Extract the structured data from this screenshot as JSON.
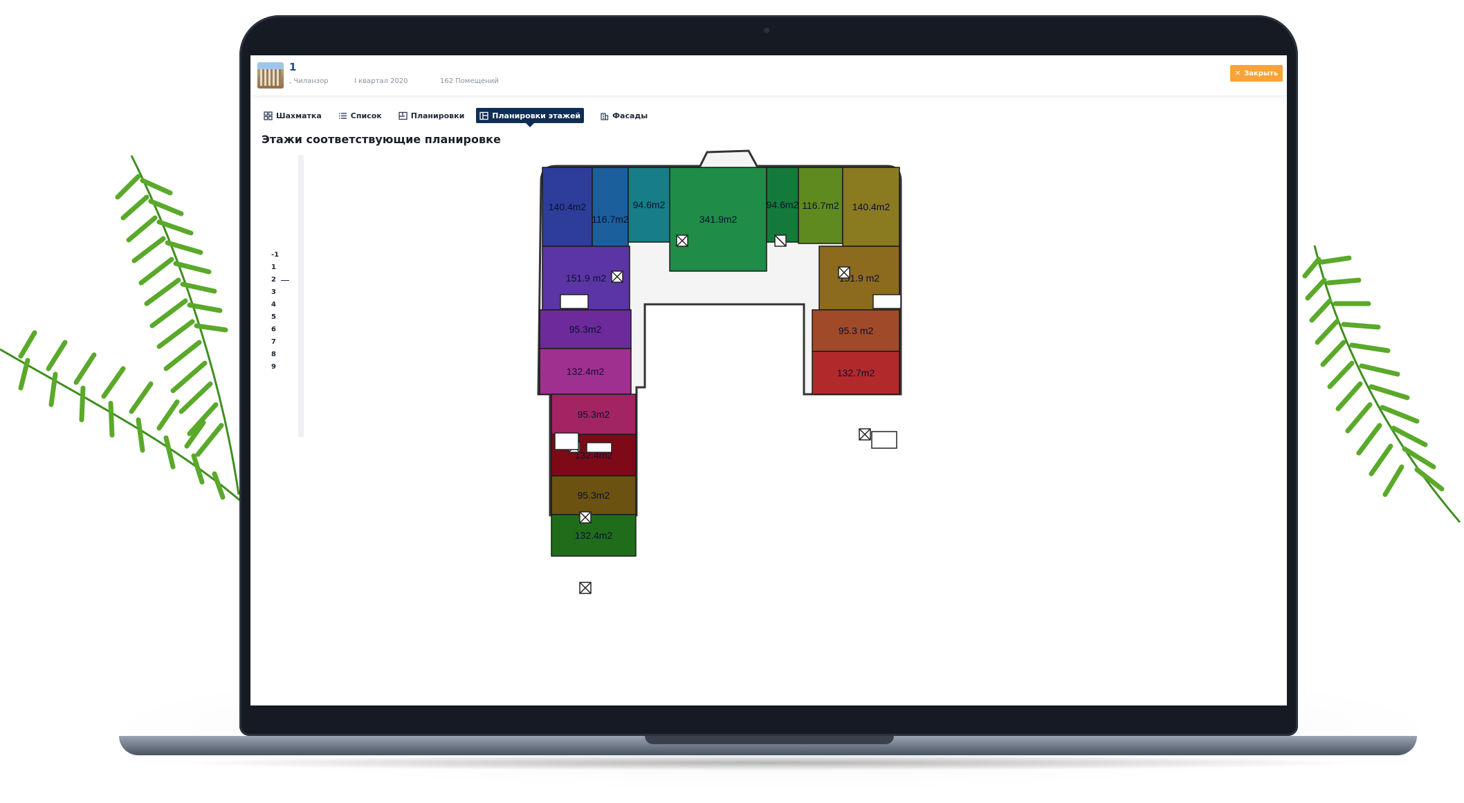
{
  "project": {
    "name": "1",
    "district": ", Чиланзор",
    "quarter": "I квартал 2020",
    "rooms_count": "162 Помещений",
    "close_label": "Закрыть",
    "close_icon": "x-icon"
  },
  "tabs": [
    {
      "label": "Шахматка",
      "icon": "grid-icon",
      "active": false
    },
    {
      "label": "Список",
      "icon": "list-icon",
      "active": false
    },
    {
      "label": "Планировки",
      "icon": "layout-icon",
      "active": false
    },
    {
      "label": "Планировки этажей",
      "icon": "floorplan-icon",
      "active": true
    },
    {
      "label": "Фасады",
      "icon": "building-icon",
      "active": false
    }
  ],
  "page_title": "Этажи соответствующие планировке",
  "floors": [
    "-1",
    "1",
    "2",
    "3",
    "4",
    "5",
    "6",
    "7",
    "8",
    "9"
  ],
  "selected_floor": "2",
  "units": [
    {
      "area": "140.4m2",
      "color": "#2e3d9a"
    },
    {
      "area": "116.7m2",
      "color": "#1b5f9c"
    },
    {
      "area": "94.6m2",
      "color": "#177d86"
    },
    {
      "area": "341.9m2",
      "color": "#1f8c48"
    },
    {
      "area": "94.6m2",
      "color": "#137a3b"
    },
    {
      "area": "116.7m2",
      "color": "#5e8a1f"
    },
    {
      "area": "140.4m2",
      "color": "#8a7a20"
    },
    {
      "area": "151.9 m2",
      "color": "#5a35a3"
    },
    {
      "area": "151.9 m2",
      "color": "#8c6a1e"
    },
    {
      "area": "95.3m2",
      "color": "#6c2a9a"
    },
    {
      "area": "95.3 m2",
      "color": "#a04a2a"
    },
    {
      "area": "132.4m2",
      "color": "#a0308f"
    },
    {
      "area": "132.7m2",
      "color": "#b2292c"
    },
    {
      "area": "95.3m2",
      "color": "#a22463"
    },
    {
      "area": "132.4m2",
      "color": "#7e0a18"
    },
    {
      "area": "95.3m2",
      "color": "#6b5210"
    },
    {
      "area": "132.4m2",
      "color": "#1f6d1a"
    }
  ]
}
